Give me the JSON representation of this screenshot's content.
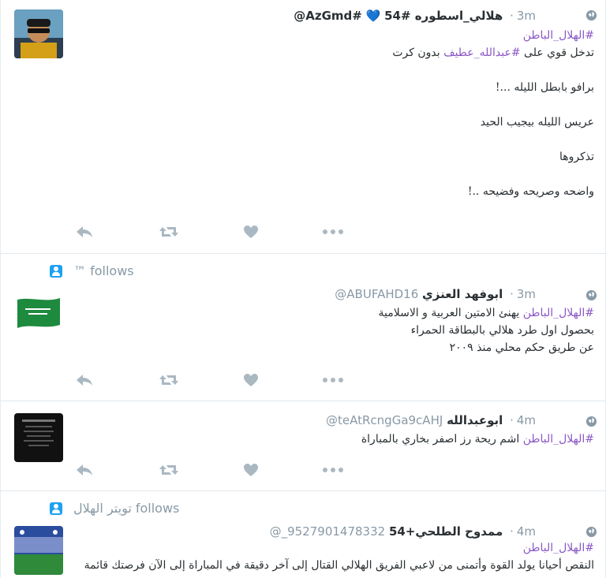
{
  "colors": {
    "link": "#8a56c6",
    "meta": "#8899a6",
    "icon": "#aab8c2",
    "follow_icon": "#1da1f2"
  },
  "tweets": [
    {
      "name": "هلالي_اسطوره #54",
      "heart": "💙",
      "handle": "@AzGmd#",
      "time": "3m",
      "lines": [
        {
          "hashtag": "#الهلال_الباطن",
          "text": ""
        },
        {
          "pre": "تدخل قوي على ",
          "hashtag": "#عبدالله_عطيف",
          "text": " بدون كرت"
        },
        {
          "text": "برافو بابطل الليله ...!"
        },
        {
          "text": "عريس الليله بيجيب الحيد"
        },
        {
          "text": "تذكروها"
        },
        {
          "text": "واضحه وصريحه وفضيحه ..!"
        }
      ]
    },
    {
      "follows": "™ follows",
      "name": "ابوفهد العنزي",
      "handle": "@ABUFAHD16",
      "time": "3m",
      "lines": [
        {
          "hashtag": "#الهلال_الباطن",
          "text": " يهنئ الامتين العربية و الاسلامية"
        },
        {
          "text": "بحصول اول طرد هلالي بالبطاقة الحمراء"
        },
        {
          "text": "عن طريق حكم محلي منذ ٢٠٠٩"
        }
      ]
    },
    {
      "name": "ابوعبدالله",
      "handle": "@teAtRcngGa9cAHJ",
      "time": "4m",
      "lines": [
        {
          "hashtag": "#الهلال_الباطن",
          "text": " اشم ريحة رز اصفر بخاري بالمباراة"
        }
      ]
    },
    {
      "follows": "تويتر الهلال follows",
      "name": "ممدوح الطلحي+54",
      "handle": "@_9527901478332",
      "time": "4m",
      "lines": [
        {
          "hashtag": "#الهلال_الباطن",
          "text": ""
        },
        {
          "text": "النقص أحيانا يولد القوة وأتمنى من لاعبي الفريق الهلالي القتال إلى آخر دقيقة في المباراة إلى الآن فرصتك قائمة"
        }
      ]
    }
  ]
}
